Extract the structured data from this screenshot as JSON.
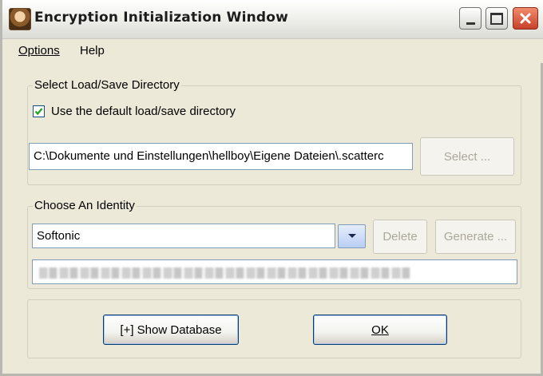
{
  "window": {
    "title": "Encryption Initialization Window"
  },
  "menu": {
    "options_label": "Options",
    "help_label": "Help"
  },
  "directory": {
    "group_label": "Select Load/Save Directory",
    "checkbox_label": "Use the default load/save directory",
    "checkbox_checked": true,
    "path_value": "C:\\Dokumente und Einstellungen\\hellboy\\Eigene Dateien\\.scatterc",
    "select_button_label": "Select ..."
  },
  "identity": {
    "group_label": "Choose An Identity",
    "selected_identity": "Softonic",
    "delete_button_label": "Delete",
    "generate_button_label": "Generate ..."
  },
  "actions": {
    "show_database_label": "[+] Show Database",
    "ok_label": "OK"
  },
  "colors": {
    "window_bg": "#ece9d8",
    "field_border": "#7f9db9",
    "button_border": "#003c74",
    "disabled_text": "#aca899",
    "close_button": "#c8402a"
  }
}
